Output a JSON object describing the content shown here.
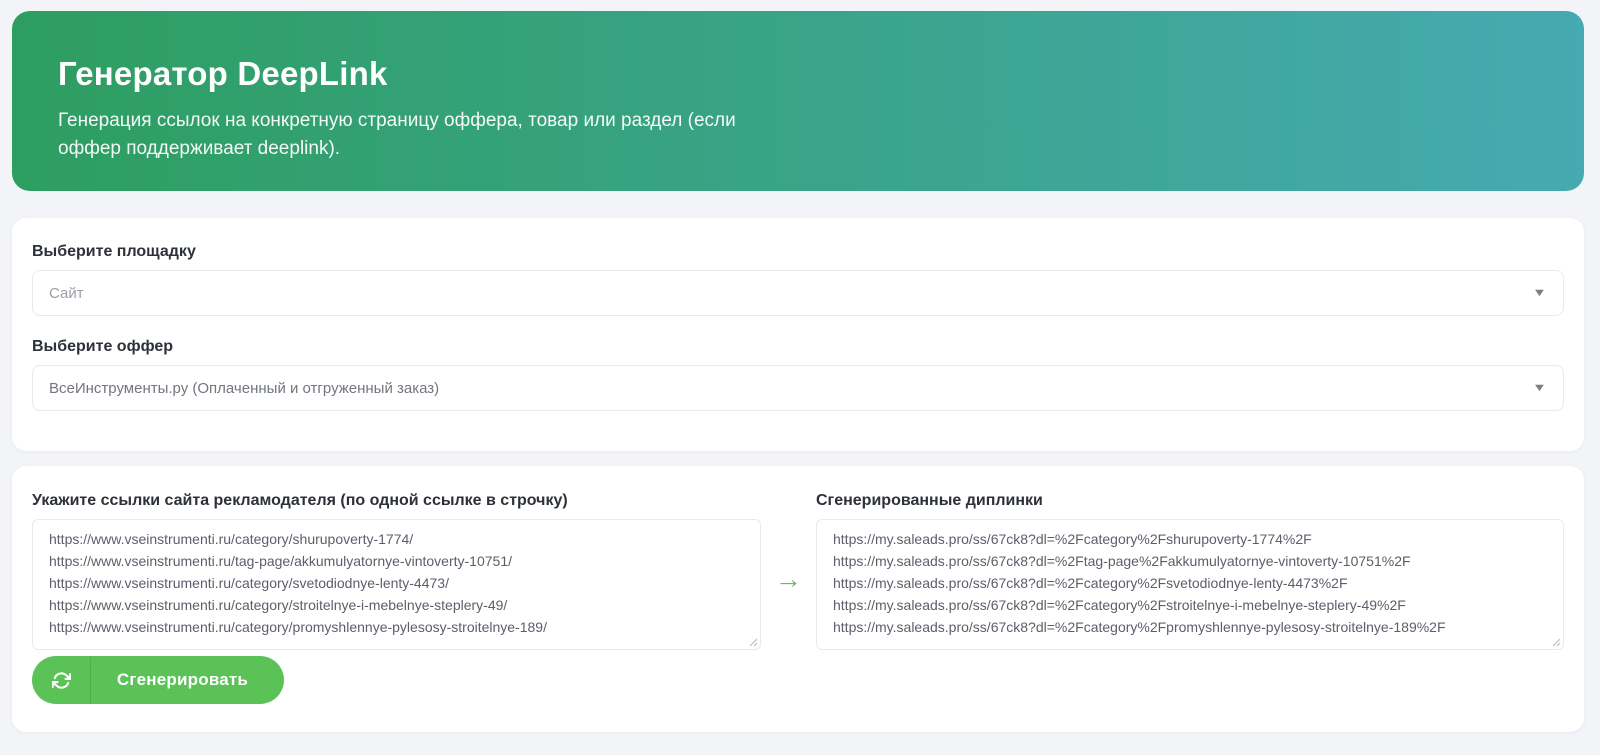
{
  "banner": {
    "title": "Генератор DeepLink",
    "subtitle": "Генерация ссылок на конкретную страницу оффера, товар или раздел (если оффер поддерживает deeplink)."
  },
  "form": {
    "platform_label": "Выберите площадку",
    "platform_value": "Сайт",
    "offer_label": "Выберите оффер",
    "offer_value": "ВсеИнструменты.ру (Оплаченный и отгруженный заказ)"
  },
  "generator": {
    "source_label": "Укажите ссылки сайта рекламодателя (по одной ссылке в строчку)",
    "source_links": [
      "https://www.vseinstrumenti.ru/category/shurupoverty-1774/",
      "https://www.vseinstrumenti.ru/tag-page/akkumulyatornye-vintoverty-10751/",
      "https://www.vseinstrumenti.ru/category/svetodiodnye-lenty-4473/",
      "https://www.vseinstrumenti.ru/category/stroitelnye-i-mebelnye-steplery-49/",
      "https://www.vseinstrumenti.ru/category/promyshlennye-pylesosy-stroitelnye-189/"
    ],
    "result_label": "Сгенерированные диплинки",
    "result_links": [
      "https://my.saleads.pro/ss/67ck8?dl=%2Fcategory%2Fshurupoverty-1774%2F",
      "https://my.saleads.pro/ss/67ck8?dl=%2Ftag-page%2Fakkumulyatornye-vintoverty-10751%2F",
      "https://my.saleads.pro/ss/67ck8?dl=%2Fcategory%2Fsvetodiodnye-lenty-4473%2F",
      "https://my.saleads.pro/ss/67ck8?dl=%2Fcategory%2Fstroitelnye-i-mebelnye-steplery-49%2F",
      "https://my.saleads.pro/ss/67ck8?dl=%2Fcategory%2Fpromyshlennye-pylesosy-stroitelnye-189%2F"
    ],
    "generate_button": "Сгенерировать"
  },
  "icons": {
    "arrow_right": "→",
    "chevron_down": "▼",
    "refresh": "sync-arrows"
  },
  "colors": {
    "banner-gradient-start": "#2d9e60",
    "banner-gradient-end": "#45aab1",
    "button-green": "#5bc257",
    "arrow-green": "#66bb66"
  }
}
